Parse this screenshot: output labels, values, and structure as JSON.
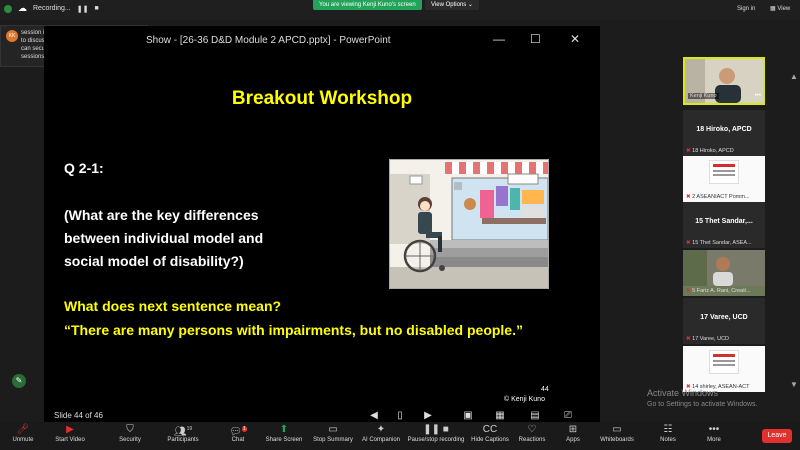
{
  "topbar": {
    "recording_label": "Recording...",
    "viewing_banner": "You are viewing Kenji Kuno's screen",
    "view_options": "View Options",
    "sign_in": "Sign in",
    "view": "View"
  },
  "notification": {
    "text": "session is to develop. You will before we start to discuss about the options. After this, we can secure the 20 min for the breakout sessions.",
    "avatar_initials": "KK"
  },
  "ppt": {
    "window_title": "Show - [26-36 D&D Module 2 APCD.pptx] - PowerPoint",
    "slide_status": "Slide 44 of 46",
    "slide": {
      "title": "Breakout Workshop",
      "question_id": "Q 2-1:",
      "question_lines": [
        "(What are the key differences",
        "between individual model and",
        "social model of disability?)"
      ],
      "prompt": "What does next sentence mean?",
      "quote": "“There are many persons with impairments, but no disabled people.”",
      "page_number": "44",
      "copyright": "© Kenji Kuno"
    }
  },
  "participants": [
    {
      "name": "Kenji Kuno",
      "display": "video"
    },
    {
      "name": "18 Hiroko, APCD",
      "sub": "18 Hiroko, APCD"
    },
    {
      "name": "",
      "sub": "2 ASEANIACT Pomm..."
    },
    {
      "name": "15 Thet Sandar,...",
      "sub": "15 Thet Sandar, ASEA..."
    },
    {
      "name": "",
      "sub": "5 Fariz A. Rani, Creati..."
    },
    {
      "name": "17 Varee, UCD",
      "sub": "17 Varee, UCD"
    },
    {
      "name": "",
      "sub": "14 shirley, ASEAN-ACT"
    }
  ],
  "windows_activation": {
    "line1": "Activate Windows",
    "line2": "Go to Settings to activate Windows."
  },
  "toolbar": {
    "unmute": "Unmute",
    "start_video": "Start Video",
    "security": "Security",
    "participants": "Participants",
    "participants_count": "19",
    "chat": "Chat",
    "chat_badge": "1",
    "share_screen": "Share Screen",
    "stop_summary": "Stop Summary",
    "ai_companion": "AI Companion",
    "pause_recording": "Pause/stop recording",
    "hide_captions": "Hide Captions",
    "reactions": "Reactions",
    "apps": "Apps",
    "whiteboards": "Whiteboards",
    "notes": "Notes",
    "more": "More",
    "leave": "Leave"
  },
  "colors": {
    "slide_yellow": "#ffff00",
    "share_green": "#23a35a",
    "leave_red": "#e0312e"
  }
}
